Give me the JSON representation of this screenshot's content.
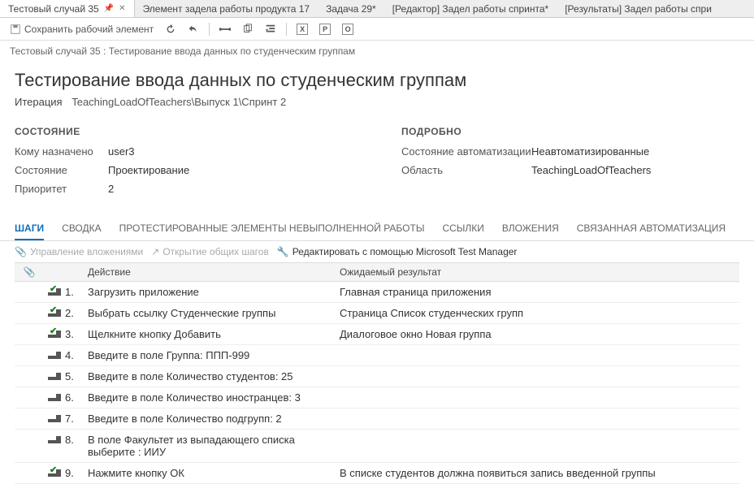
{
  "tabs": [
    {
      "label": "Тестовый случай 35",
      "pinned": true,
      "closable": true,
      "active": true
    },
    {
      "label": "Элемент задела работы продукта 17"
    },
    {
      "label": "Задача 29*"
    },
    {
      "label": "[Редактор] Задел работы спринта*"
    },
    {
      "label": "[Результаты] Задел работы спри"
    }
  ],
  "toolbar": {
    "save_label": "Сохранить рабочий элемент"
  },
  "breadcrumb": "Тестовый случай 35 : Тестирование ввода данных по студенческим группам",
  "title": "Тестирование ввода данных по студенческим группам",
  "iteration": {
    "label": "Итерация",
    "value": "TeachingLoadOfTeachers\\Выпуск 1\\Спринт 2"
  },
  "state_section": {
    "heading": "СОСТОЯНИЕ",
    "fields": [
      {
        "label": "Кому назначено",
        "value": "user3"
      },
      {
        "label": "Состояние",
        "value": "Проектирование"
      },
      {
        "label": "Приоритет",
        "value": "2"
      }
    ]
  },
  "detail_section": {
    "heading": "ПОДРОБНО",
    "fields": [
      {
        "label": "Состояние автоматизации",
        "value": "Неавтоматизированные"
      },
      {
        "label": "Область",
        "value": "TeachingLoadOfTeachers"
      }
    ]
  },
  "subtabs": [
    "ШАГИ",
    "СВОДКА",
    "ПРОТЕСТИРОВАННЫЕ ЭЛЕМЕНТЫ НЕВЫПОЛНЕННОЙ РАБОТЫ",
    "ССЫЛКИ",
    "ВЛОЖЕНИЯ",
    "СВЯЗАННАЯ АВТОМАТИЗАЦИЯ"
  ],
  "steps_toolbar": {
    "manage_attach": "Управление вложениями",
    "open_shared": "Открытие общих шагов",
    "edit_mtm": "Редактировать с помощью Microsoft Test Manager"
  },
  "grid": {
    "headers": {
      "action": "Действие",
      "result": "Ожидаемый результат"
    },
    "rows": [
      {
        "num": "1.",
        "check": true,
        "action": "Загрузить приложение",
        "result": "Главная страница приложения"
      },
      {
        "num": "2.",
        "check": true,
        "action": "Выбрать ссылку Студенческие группы",
        "result": "Страница Список студенческих групп"
      },
      {
        "num": "3.",
        "check": true,
        "action": "Щелкните кнопку Добавить",
        "result": "Диалоговое окно Новая группа"
      },
      {
        "num": "4.",
        "check": false,
        "action": "Введите в поле Группа: ППП-999",
        "result": ""
      },
      {
        "num": "5.",
        "check": false,
        "action": "Введите в поле Количество студентов: 25",
        "result": ""
      },
      {
        "num": "6.",
        "check": false,
        "action": "Введите в поле Количество иностранцев: 3",
        "result": ""
      },
      {
        "num": "7.",
        "check": false,
        "action": "Введите в поле Количество подгрупп: 2",
        "result": ""
      },
      {
        "num": "8.",
        "check": false,
        "action": "В поле Факультет из выпадающего списка выберите : ИИУ",
        "result": ""
      },
      {
        "num": "9.",
        "check": true,
        "action": "Нажмите кнопку ОК",
        "result": "В списке студентов должна появиться запись введенной группы"
      }
    ]
  }
}
